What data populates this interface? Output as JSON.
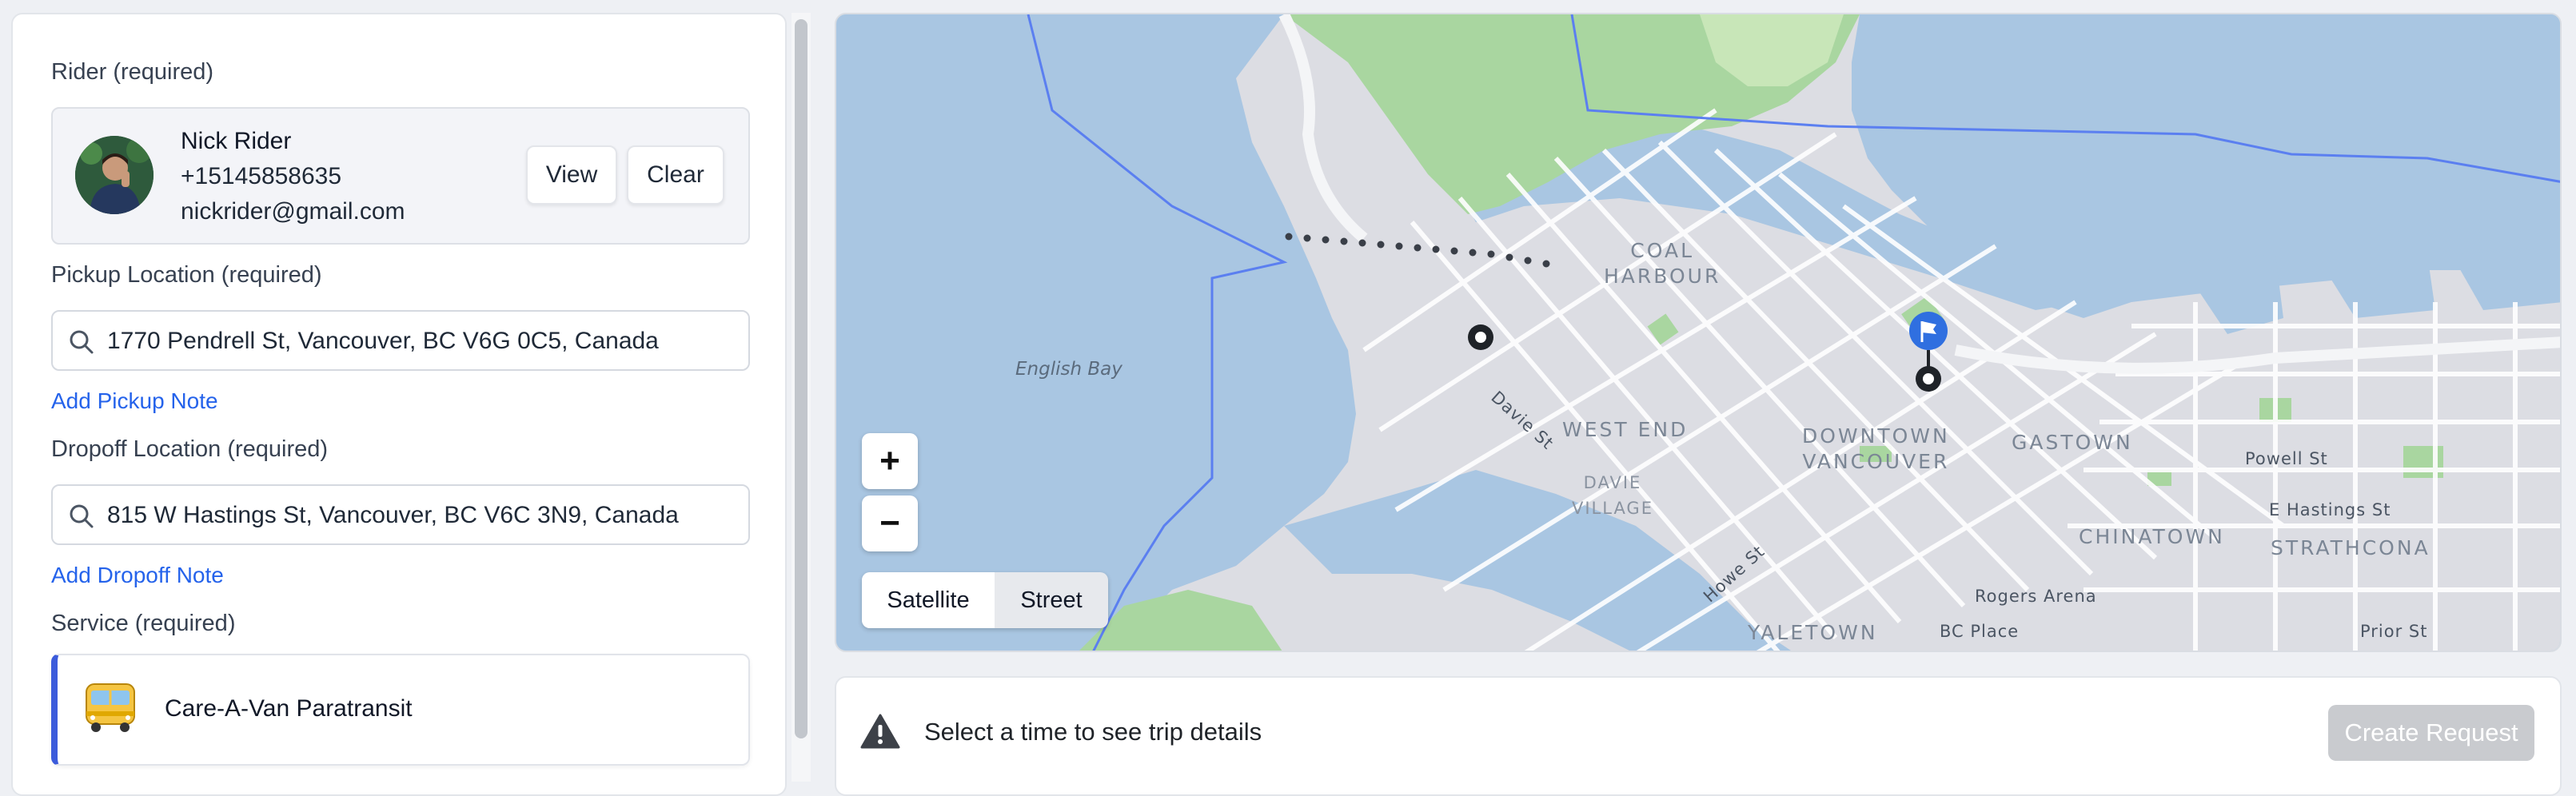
{
  "rider": {
    "label": "Rider (required)",
    "name": "Nick Rider",
    "phone": "+15145858635",
    "email": "nickrider@gmail.com",
    "view_label": "View",
    "clear_label": "Clear"
  },
  "pickup": {
    "label": "Pickup Location (required)",
    "value": "1770 Pendrell St, Vancouver, BC V6G 0C5, Canada",
    "note_link": "Add Pickup Note"
  },
  "dropoff": {
    "label": "Dropoff Location (required)",
    "value": "815 W Hastings St, Vancouver, BC V6C 3N9, Canada",
    "note_link": "Add Dropoff Note"
  },
  "service": {
    "label": "Service (required)",
    "name": "Care-A-Van Paratransit",
    "icon": "bus-icon"
  },
  "map": {
    "labels": {
      "coal_harbour": "COAL\nHARBOUR",
      "west_end": "WEST END",
      "davie_village": "DAVIE\nVILLAGE",
      "downtown": "DOWNTOWN\nVANCOUVER",
      "gastown": "GASTOWN",
      "chinatown": "CHINATOWN",
      "strathcona": "STRATHCONA",
      "yaletown": "YALETOWN",
      "english_bay": "English Bay",
      "davie_st": "Davie St",
      "howe_st": "Howe St",
      "powell_st": "Powell St",
      "e_hastings_st": "E Hastings St",
      "rogers_arena": "Rogers Arena",
      "bc_place": "BC Place",
      "prior_st": "Prior St"
    },
    "zoom_in": "+",
    "zoom_out": "−",
    "layers": {
      "satellite": "Satellite",
      "street": "Street",
      "selected": "Satellite"
    },
    "colors": {
      "water": "#a9c6e2",
      "land": "#dcdde3",
      "park": "#a9d6a0",
      "route": "#3a3f48",
      "marker": "#2f6fe0"
    }
  },
  "footer": {
    "message": "Select a time to see trip details",
    "create_label": "Create Request",
    "warning_icon": "warning-icon"
  }
}
